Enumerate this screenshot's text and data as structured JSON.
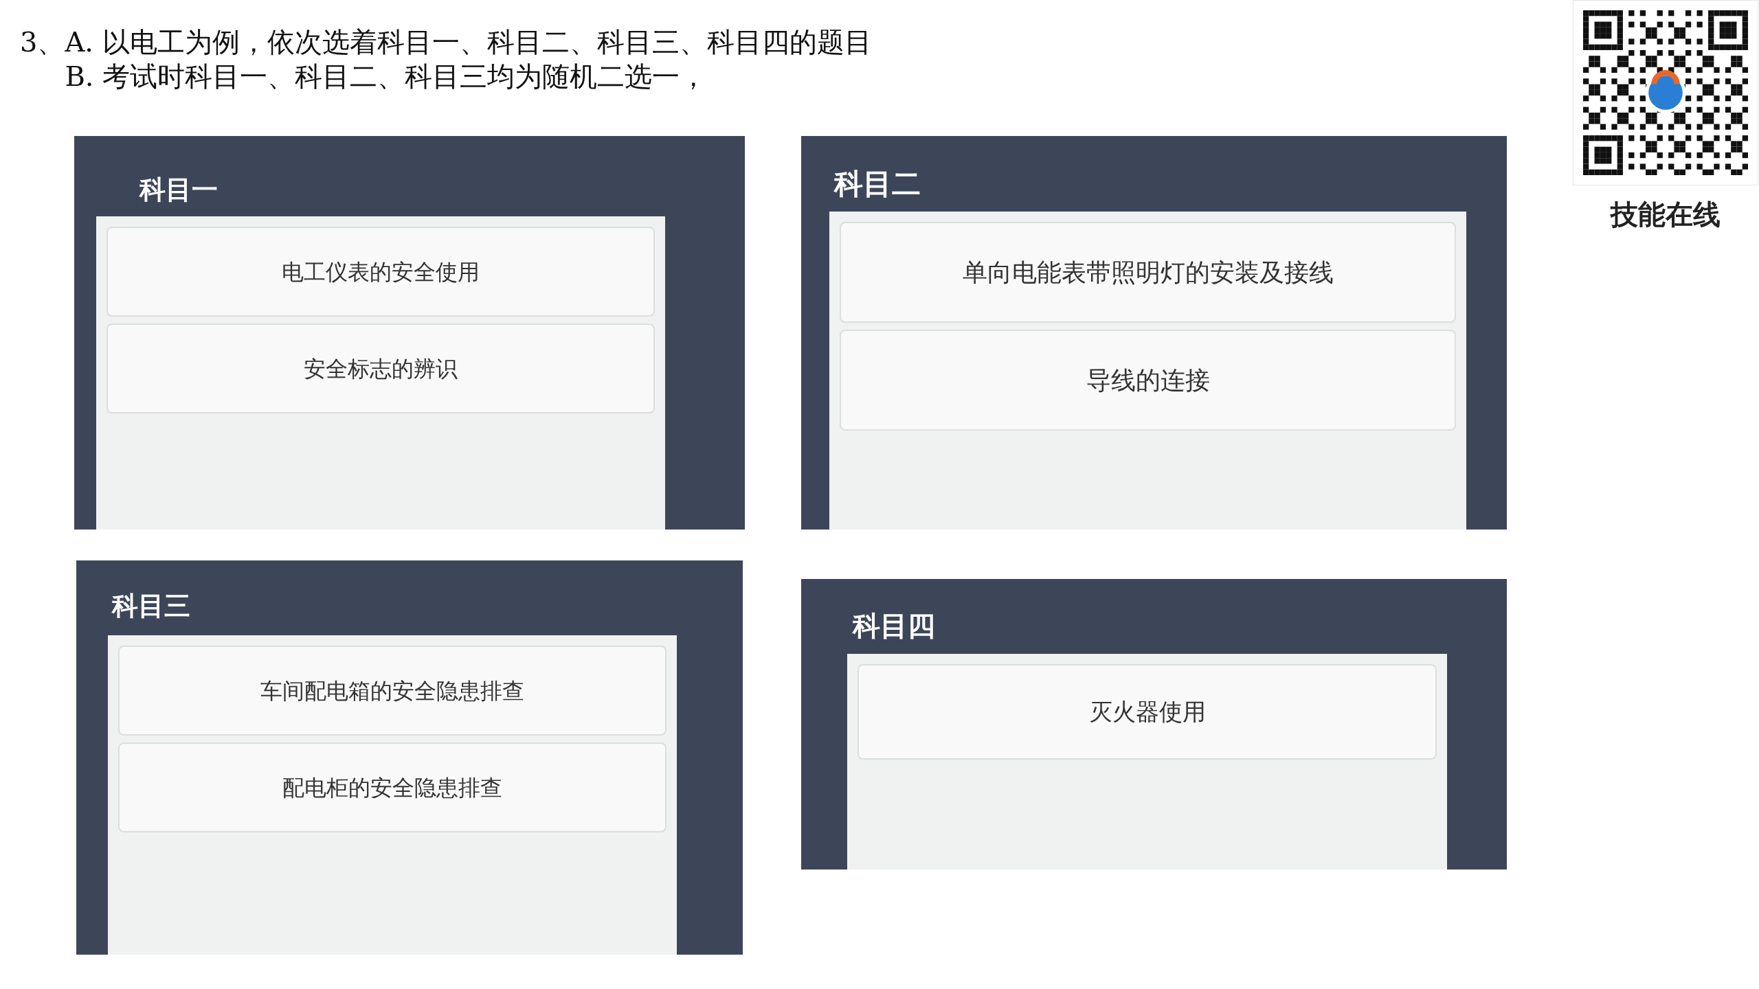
{
  "instructions": {
    "number": "3、",
    "lines": [
      "A. 以电工为例，依次选着科目一、科目二、科目三、科目四的题目",
      "B. 考试时科目一、科目二、科目三均为随机二选一，"
    ]
  },
  "panels": [
    {
      "title": "科目一",
      "items": [
        "电工仪表的安全使用",
        "安全标志的辨识"
      ]
    },
    {
      "title": "科目二",
      "items": [
        "单向电能表带照明灯的安装及接线",
        "导线的连接"
      ]
    },
    {
      "title": "科目三",
      "items": [
        "车间配电箱的安全隐患排查",
        "配电柜的安全隐患排查"
      ]
    },
    {
      "title": "科目四",
      "items": [
        "灭火器使用"
      ]
    }
  ],
  "qr": {
    "caption": "技能在线"
  }
}
